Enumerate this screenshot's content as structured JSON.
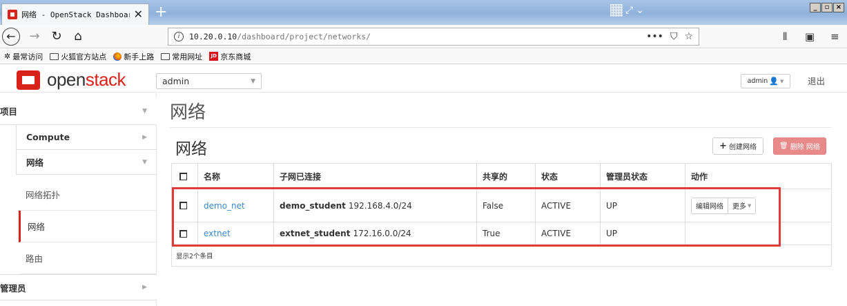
{
  "browser": {
    "tab_title": "网络 - OpenStack Dashboard",
    "tab_close": "✕",
    "new_tab": "+",
    "url_host": "10.20.0.10",
    "url_path": "/dashboard/project/networks/",
    "url_more": "•••",
    "bookmarks": [
      "最常访问",
      "火狐官方站点",
      "新手上路",
      "常用网址",
      "京东商城"
    ]
  },
  "header": {
    "logo_open": "open",
    "logo_stack": "stack",
    "project": "admin",
    "user": "admin",
    "logout": "退出"
  },
  "sidebar": {
    "project": "项目",
    "compute": "Compute",
    "network": "网络",
    "items": [
      "网络拓扑",
      "网络",
      "路由"
    ],
    "admin": "管理员"
  },
  "main": {
    "page_title": "网络",
    "section_title": "网络",
    "create_button": "创建网络",
    "delete_button": "删除 网络",
    "columns": [
      "名称",
      "子网已连接",
      "共享的",
      "状态",
      "管理员状态",
      "动作"
    ],
    "rows": [
      {
        "name": "demo_net",
        "subnet_name": "demo_student",
        "subnet_cidr": "192.168.4.0/24",
        "shared": "False",
        "status": "ACTIVE",
        "admin_state": "UP",
        "edit": "编辑网络",
        "more": "更多"
      },
      {
        "name": "extnet",
        "subnet_name": "extnet_student",
        "subnet_cidr": "172.16.0.0/24",
        "shared": "True",
        "status": "ACTIVE",
        "admin_state": "UP"
      }
    ],
    "footer": "显示2个条目"
  },
  "colors": {
    "brand": "#d9231a",
    "link": "#3a88c8",
    "danger": "#e8898a",
    "highlight": "#e03a3a"
  }
}
